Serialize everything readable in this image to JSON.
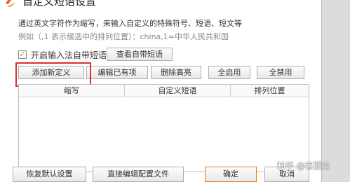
{
  "title": "自定义短语设置",
  "description": "通过英文字符作为缩写，来输入自定义的特殊符号、短语、短文等",
  "example": "例如（,1 表示候选中的排列位置）：china,1=中华人民共和国",
  "enable_checkbox": {
    "label": "开启输入法自带短语",
    "checked": true
  },
  "buttons": {
    "view_builtin": "查看自带短语",
    "add_new": "添加新定义",
    "edit_existing": "编辑已有项",
    "delete_highlighted": "删除高亮",
    "enable_all": "全启用",
    "disable_all": "全禁用"
  },
  "table": {
    "columns": [
      "缩写",
      "自定义短语",
      "排列位置"
    ],
    "rows": []
  },
  "footer": {
    "restore_defaults": "恢复默认设置",
    "edit_config": "直接编辑配置文件",
    "ok": "确定",
    "cancel": "取消"
  },
  "watermark": "知乎 @客服宝",
  "colors": {
    "highlight": "#d9312f",
    "check_mark": "#e67e22",
    "icon": "#e8622c"
  }
}
